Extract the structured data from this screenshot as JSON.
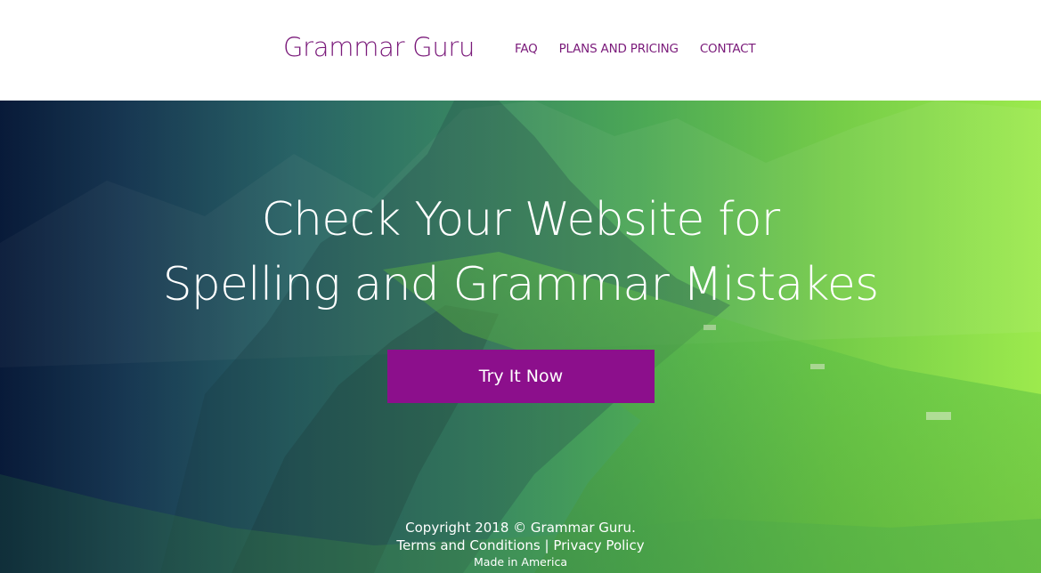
{
  "header": {
    "brand": "Grammar Guru",
    "nav": [
      "FAQ",
      "PLANS AND PRICING",
      "CONTACT"
    ]
  },
  "hero": {
    "headline_line1": "Check Your Website for",
    "headline_line2": "Spelling and Grammar Mistakes",
    "cta_label": "Try It Now"
  },
  "footer": {
    "copyright": "Copyright 2018 © Grammar Guru.",
    "terms": "Terms and Conditions",
    "separator": "|",
    "privacy": "Privacy Policy",
    "made_in": "Made in America"
  },
  "colors": {
    "brand": "#7a1a7a",
    "cta": "#8c0f8c",
    "hero_start": "#0b2144",
    "hero_end": "#9be94b"
  }
}
